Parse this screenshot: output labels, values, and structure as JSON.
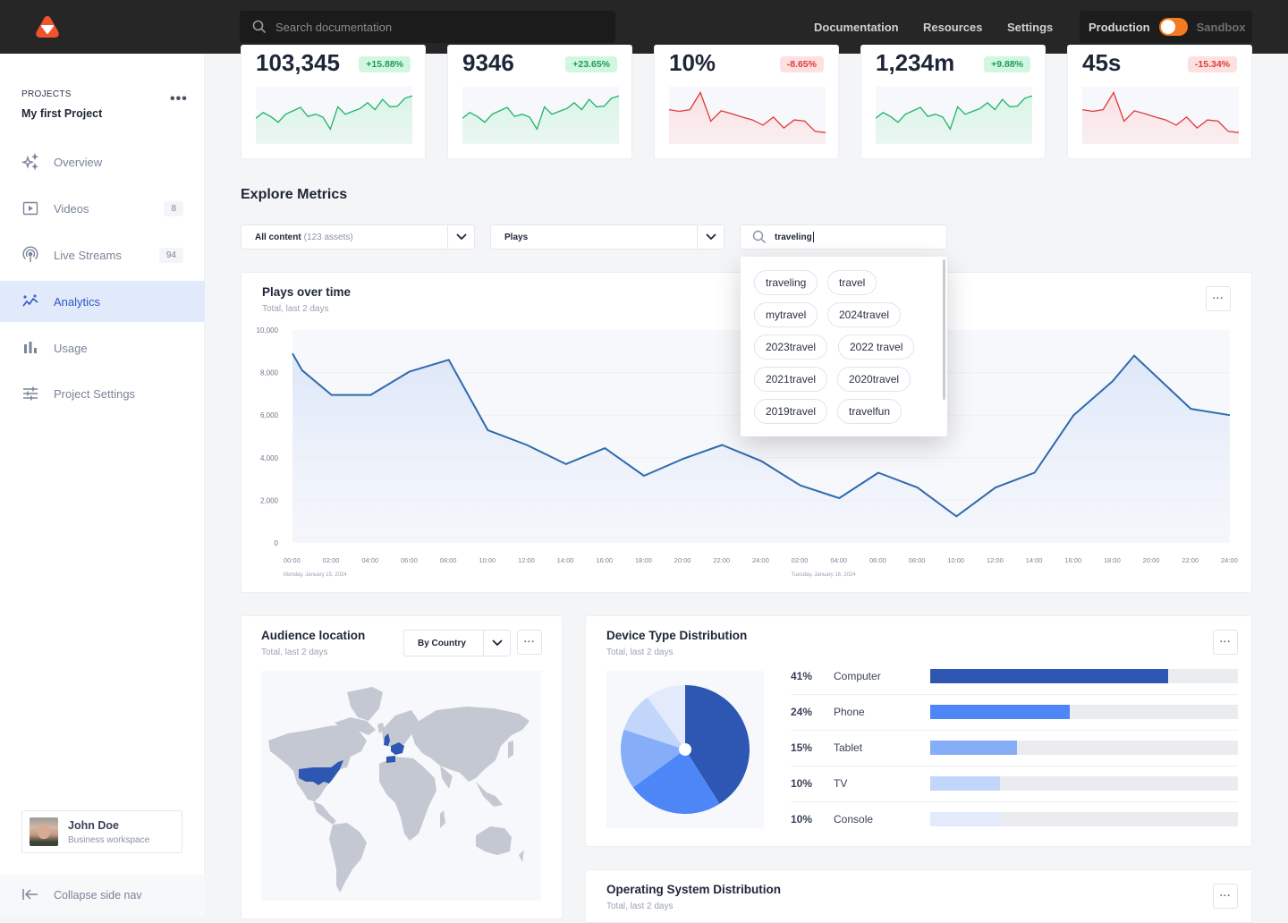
{
  "topbar": {
    "search_placeholder": "Search documentation",
    "nav": [
      "Documentation",
      "Resources",
      "Settings"
    ],
    "env_on": "Production",
    "env_off": "Sandbox",
    "brand_color": "#f0532d",
    "toggle_color": "#f47b20"
  },
  "sidebar": {
    "section_label": "PROJECTS",
    "project_name": "My first Project",
    "items": [
      {
        "label": "Overview",
        "icon": "sparkles-icon"
      },
      {
        "label": "Videos",
        "icon": "play-icon",
        "badge": "8"
      },
      {
        "label": "Live Streams",
        "icon": "broadcast-icon",
        "badge": "94"
      },
      {
        "label": "Analytics",
        "icon": "analytics-icon",
        "active": true
      },
      {
        "label": "Usage",
        "icon": "bar-chart-icon"
      },
      {
        "label": "Project Settings",
        "icon": "sliders-icon"
      }
    ],
    "user": {
      "name": "John Doe",
      "workspace": "Business workspace"
    },
    "collapse_label": "Collapse side nav"
  },
  "stats": [
    {
      "value": "103,345",
      "change": "+15.88%",
      "trend": "up",
      "spark": [
        45,
        55,
        48,
        38,
        52,
        58,
        64,
        48,
        52,
        47,
        26,
        65,
        52,
        57,
        62,
        72,
        60,
        78,
        65,
        66,
        80,
        84
      ]
    },
    {
      "value": "9346",
      "change": "+23.65%",
      "trend": "up",
      "spark": [
        45,
        55,
        48,
        38,
        52,
        58,
        64,
        48,
        52,
        47,
        26,
        65,
        52,
        57,
        62,
        72,
        60,
        78,
        65,
        66,
        80,
        84
      ]
    },
    {
      "value": "10%",
      "change": "-8.65%",
      "trend": "down",
      "spark": [
        60,
        57,
        60,
        90,
        40,
        58,
        53,
        47,
        42,
        33,
        47,
        28,
        42,
        40,
        22,
        20
      ]
    },
    {
      "value": "1,234m",
      "change": "+9.88%",
      "trend": "up",
      "spark": [
        45,
        55,
        48,
        38,
        52,
        58,
        64,
        48,
        52,
        47,
        26,
        65,
        52,
        57,
        62,
        72,
        60,
        78,
        65,
        66,
        80,
        84
      ]
    },
    {
      "value": "45s",
      "change": "-15.34%",
      "trend": "down",
      "spark": [
        60,
        57,
        60,
        90,
        40,
        58,
        53,
        47,
        42,
        33,
        47,
        28,
        42,
        40,
        22,
        20
      ]
    }
  ],
  "explore": {
    "title": "Explore Metrics",
    "content_filter": "All content",
    "content_count": "(123 assets)",
    "metric_filter": "Plays",
    "tag_search_value": "traveling",
    "tag_suggestions": [
      "traveling",
      "travel",
      "mytravel",
      "2024travel",
      "2023travel",
      "2022 travel",
      "2021travel",
      "2020travel",
      "2019travel",
      "travelfun"
    ]
  },
  "plays_card": {
    "title": "Plays over time",
    "subtitle": "Total, last 2 days"
  },
  "audience_card": {
    "title": "Audience location",
    "subtitle": "Total, last 2 days",
    "group_by": "By Country",
    "highlighted_countries": [
      "United States",
      "United Kingdom",
      "France",
      "Germany",
      "Spain",
      "Belgium",
      "Netherlands"
    ]
  },
  "device_card": {
    "title": "Device Type Distribution",
    "subtitle": "Total, last 2 days"
  },
  "os_card": {
    "title": "Operating System Distribution",
    "subtitle": "Total, last 2 days"
  },
  "chart_data": [
    {
      "type": "area",
      "title": "Plays over time",
      "subtitle": "Total, last 2 days",
      "xlabel": "",
      "ylabel": "",
      "ylim": [
        0,
        10000
      ],
      "yticks": [
        "0",
        "2,000",
        "4,000",
        "6,000",
        "8,000",
        "10,000"
      ],
      "xticks": [
        "00:00",
        "02:00",
        "04:00",
        "06:00",
        "08:00",
        "10:00",
        "12:00",
        "14:00",
        "16:00",
        "18:00",
        "20:00",
        "22:00",
        "24:00",
        "02:00",
        "04:00",
        "06:00",
        "08:00",
        "10:00",
        "12:00",
        "14:00",
        "16:00",
        "18:00",
        "20:00",
        "22:00",
        "24:00"
      ],
      "date_labels": [
        "Monday, January 15, 2024",
        "Tuesday, January 16, 2024"
      ],
      "x_hours": [
        0,
        0.5,
        2,
        4,
        6,
        8,
        10,
        12,
        14,
        16,
        18,
        20,
        22,
        24,
        26,
        28,
        30,
        32,
        34,
        36,
        38,
        40,
        42,
        43.1,
        46,
        48
      ],
      "values": [
        8900,
        8100,
        6950,
        6950,
        8050,
        8600,
        5300,
        4600,
        3700,
        4450,
        3150,
        3950,
        4600,
        3850,
        2700,
        2100,
        3300,
        2600,
        1250,
        2600,
        3300,
        6000,
        7600,
        8800,
        6300,
        6000
      ],
      "color": "#2f6aad",
      "grid": true
    },
    {
      "type": "pie",
      "title": "Device Type Distribution",
      "categories": [
        "Computer",
        "Phone",
        "Tablet",
        "TV",
        "Console"
      ],
      "values": [
        41,
        24,
        15,
        10,
        10
      ],
      "labels": [
        "41%",
        "24%",
        "15%",
        "10%",
        "10%"
      ],
      "colors": [
        "#2d57b3",
        "#4d87f7",
        "#86aef8",
        "#c2d5fb",
        "#e2eafc"
      ]
    }
  ]
}
